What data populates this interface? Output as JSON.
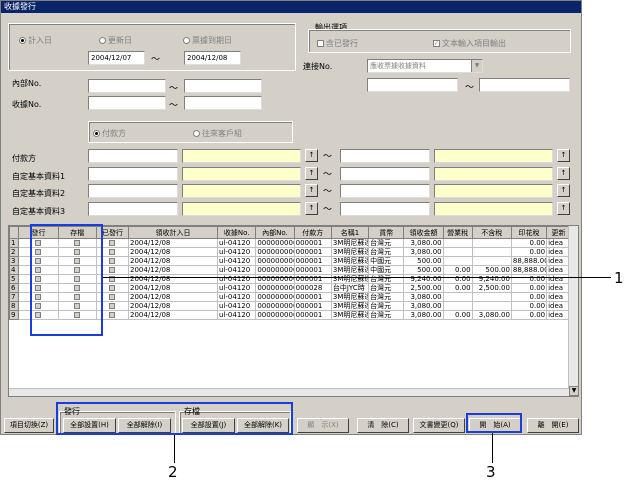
{
  "window": {
    "title": "收據發行"
  },
  "date_mode": {
    "options": [
      {
        "label": "計入日",
        "selected": true
      },
      {
        "label": "更新日",
        "selected": false
      },
      {
        "label": "票據到期日",
        "selected": false
      }
    ],
    "from": "2004/12/07",
    "to": "2004/12/08",
    "tilde": "～"
  },
  "output_options": {
    "legend": "輸出選項",
    "include_issued": "含已發行",
    "print_document_input": "文本輸入項目輸出",
    "include_issued_checked": false,
    "print_document_input_checked": true
  },
  "connect": {
    "label": "連接No.",
    "select": "應收票據收據資料"
  },
  "internal_no": {
    "label": "內部No."
  },
  "receipt_no": {
    "label": "收據No."
  },
  "payer_type": {
    "options": [
      {
        "label": "付款方",
        "selected": true
      },
      {
        "label": "往來客戶組",
        "selected": false
      }
    ]
  },
  "filters": [
    {
      "label": "付款方"
    },
    {
      "label": "自定基本資料1"
    },
    {
      "label": "自定基本資料2"
    },
    {
      "label": "自定基本資料3"
    }
  ],
  "lookup_btn": "↑",
  "grid": {
    "headers": [
      "發行",
      "存檔",
      "已發行",
      "領收計入日",
      "收據No.",
      "內部No.",
      "付款方",
      "名稱1",
      "貨幣",
      "領收金額",
      "營業稅",
      "不含稅",
      "印花稅",
      "更新"
    ],
    "rows": [
      {
        "n": "1",
        "date": "2004/12/08",
        "receipt": "ul-04120",
        "internal": "0000000000",
        "payer": "000001",
        "name": "3M明尼蘇達",
        "cur": "台灣元",
        "amt": "3,080.00",
        "tax": "",
        "net": "",
        "stamp": "0.00",
        "upd": "idea"
      },
      {
        "n": "2",
        "date": "2004/12/08",
        "receipt": "ul-04120",
        "internal": "0000000000",
        "payer": "000001",
        "name": "3M明尼蘇達",
        "cur": "台灣元",
        "amt": "3,080.00",
        "tax": "",
        "net": "",
        "stamp": "0.00",
        "upd": "idea"
      },
      {
        "n": "3",
        "date": "2004/12/08",
        "receipt": "ul-04120",
        "internal": "0000000000",
        "payer": "000001",
        "name": "3M明尼蘇達",
        "cur": "中國元",
        "amt": "500.00",
        "tax": "",
        "net": "",
        "stamp": "88,888.00",
        "upd": "idea"
      },
      {
        "n": "4",
        "date": "2004/12/08",
        "receipt": "ul-04120",
        "internal": "0000000000",
        "payer": "000001",
        "name": "3M明尼蘇達",
        "cur": "中國元",
        "amt": "500.00",
        "tax": "0.00",
        "net": "500.00",
        "stamp": "88,888.00",
        "upd": "idea"
      },
      {
        "n": "5",
        "date": "2004/12/08",
        "receipt": "ul-04120",
        "internal": "0000000000",
        "payer": "000001",
        "name": "3M明尼蘇達",
        "cur": "台灣元",
        "amt": "9,240.00",
        "tax": "0.00",
        "net": "9,240.00",
        "stamp": "0.00",
        "upd": "idea"
      },
      {
        "n": "6",
        "date": "2004/12/08",
        "receipt": "ul-04120",
        "internal": "0000000000",
        "payer": "000028",
        "name": "台中JYC時",
        "cur": "台灣元",
        "amt": "2,500.00",
        "tax": "0.00",
        "net": "2,500.00",
        "stamp": "0.00",
        "upd": "idea"
      },
      {
        "n": "7",
        "date": "2004/12/08",
        "receipt": "ul-04120",
        "internal": "0000000000",
        "payer": "000001",
        "name": "3M明尼蘇達",
        "cur": "台灣元",
        "amt": "3,080.00",
        "tax": "",
        "net": "",
        "stamp": "0.00",
        "upd": "idea"
      },
      {
        "n": "8",
        "date": "2004/12/08",
        "receipt": "ul-04120",
        "internal": "0000000000",
        "payer": "000001",
        "name": "3M明尼蘇達",
        "cur": "台灣元",
        "amt": "3,080.00",
        "tax": "",
        "net": "",
        "stamp": "0.00",
        "upd": "idea"
      },
      {
        "n": "9",
        "date": "2004/12/08",
        "receipt": "ul-04120",
        "internal": "0000000000",
        "payer": "000001",
        "name": "3M明尼蘇達",
        "cur": "台灣元",
        "amt": "3,080.00",
        "tax": "0.00",
        "net": "3,080.00",
        "stamp": "0.00",
        "upd": "idea"
      }
    ]
  },
  "buttons": {
    "switch_items": "項目切換(Z)",
    "issue_group": "發行",
    "issue_set_all": "全部設置(H)",
    "issue_clear_all": "全部解除(I)",
    "save_group": "存檔",
    "save_set_all": "全部設置(J)",
    "save_clear_all": "全部解除(K)",
    "display": "顯　示(X)",
    "clear": "清　除(C)",
    "doc_change": "文書變更(Q)",
    "start": "開　始(A)",
    "close": "離　開(E)"
  },
  "callouts": [
    "1",
    "2",
    "3"
  ],
  "colors": {
    "highlight": "#1a3fd9",
    "title_bar": "#0a246a",
    "yellow_field": "#ffffcc"
  }
}
